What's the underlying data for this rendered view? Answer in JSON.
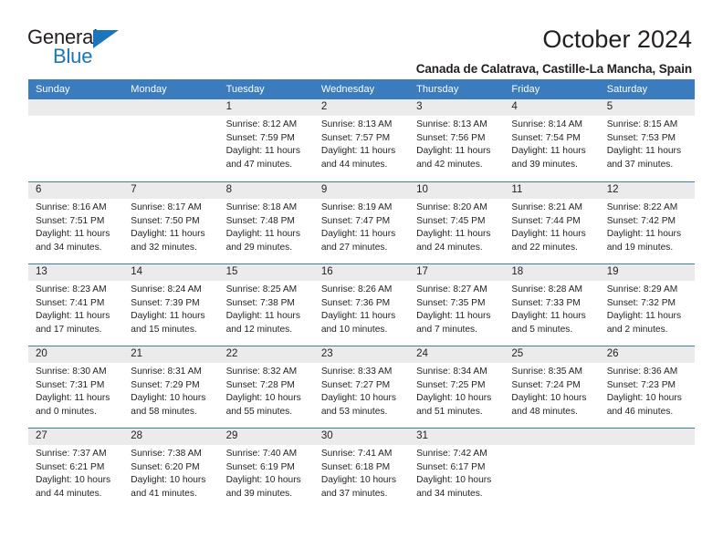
{
  "brand": {
    "name_top": "General",
    "name_bottom": "Blue",
    "triangle_color": "#1b75bb"
  },
  "header": {
    "title": "October 2024",
    "location": "Canada de Calatrava, Castille-La Mancha, Spain"
  },
  "theme": {
    "header_blue": "#3a7cbe",
    "daynum_band": "#ebebeb",
    "text": "#231f20"
  },
  "calendar": {
    "weekdays": [
      "Sunday",
      "Monday",
      "Tuesday",
      "Wednesday",
      "Thursday",
      "Friday",
      "Saturday"
    ],
    "weeks": [
      [
        {
          "day": "",
          "lines": []
        },
        {
          "day": "",
          "lines": []
        },
        {
          "day": "1",
          "lines": [
            "Sunrise: 8:12 AM",
            "Sunset: 7:59 PM",
            "Daylight: 11 hours",
            "and 47 minutes."
          ]
        },
        {
          "day": "2",
          "lines": [
            "Sunrise: 8:13 AM",
            "Sunset: 7:57 PM",
            "Daylight: 11 hours",
            "and 44 minutes."
          ]
        },
        {
          "day": "3",
          "lines": [
            "Sunrise: 8:13 AM",
            "Sunset: 7:56 PM",
            "Daylight: 11 hours",
            "and 42 minutes."
          ]
        },
        {
          "day": "4",
          "lines": [
            "Sunrise: 8:14 AM",
            "Sunset: 7:54 PM",
            "Daylight: 11 hours",
            "and 39 minutes."
          ]
        },
        {
          "day": "5",
          "lines": [
            "Sunrise: 8:15 AM",
            "Sunset: 7:53 PM",
            "Daylight: 11 hours",
            "and 37 minutes."
          ]
        }
      ],
      [
        {
          "day": "6",
          "lines": [
            "Sunrise: 8:16 AM",
            "Sunset: 7:51 PM",
            "Daylight: 11 hours",
            "and 34 minutes."
          ]
        },
        {
          "day": "7",
          "lines": [
            "Sunrise: 8:17 AM",
            "Sunset: 7:50 PM",
            "Daylight: 11 hours",
            "and 32 minutes."
          ]
        },
        {
          "day": "8",
          "lines": [
            "Sunrise: 8:18 AM",
            "Sunset: 7:48 PM",
            "Daylight: 11 hours",
            "and 29 minutes."
          ]
        },
        {
          "day": "9",
          "lines": [
            "Sunrise: 8:19 AM",
            "Sunset: 7:47 PM",
            "Daylight: 11 hours",
            "and 27 minutes."
          ]
        },
        {
          "day": "10",
          "lines": [
            "Sunrise: 8:20 AM",
            "Sunset: 7:45 PM",
            "Daylight: 11 hours",
            "and 24 minutes."
          ]
        },
        {
          "day": "11",
          "lines": [
            "Sunrise: 8:21 AM",
            "Sunset: 7:44 PM",
            "Daylight: 11 hours",
            "and 22 minutes."
          ]
        },
        {
          "day": "12",
          "lines": [
            "Sunrise: 8:22 AM",
            "Sunset: 7:42 PM",
            "Daylight: 11 hours",
            "and 19 minutes."
          ]
        }
      ],
      [
        {
          "day": "13",
          "lines": [
            "Sunrise: 8:23 AM",
            "Sunset: 7:41 PM",
            "Daylight: 11 hours",
            "and 17 minutes."
          ]
        },
        {
          "day": "14",
          "lines": [
            "Sunrise: 8:24 AM",
            "Sunset: 7:39 PM",
            "Daylight: 11 hours",
            "and 15 minutes."
          ]
        },
        {
          "day": "15",
          "lines": [
            "Sunrise: 8:25 AM",
            "Sunset: 7:38 PM",
            "Daylight: 11 hours",
            "and 12 minutes."
          ]
        },
        {
          "day": "16",
          "lines": [
            "Sunrise: 8:26 AM",
            "Sunset: 7:36 PM",
            "Daylight: 11 hours",
            "and 10 minutes."
          ]
        },
        {
          "day": "17",
          "lines": [
            "Sunrise: 8:27 AM",
            "Sunset: 7:35 PM",
            "Daylight: 11 hours",
            "and 7 minutes."
          ]
        },
        {
          "day": "18",
          "lines": [
            "Sunrise: 8:28 AM",
            "Sunset: 7:33 PM",
            "Daylight: 11 hours",
            "and 5 minutes."
          ]
        },
        {
          "day": "19",
          "lines": [
            "Sunrise: 8:29 AM",
            "Sunset: 7:32 PM",
            "Daylight: 11 hours",
            "and 2 minutes."
          ]
        }
      ],
      [
        {
          "day": "20",
          "lines": [
            "Sunrise: 8:30 AM",
            "Sunset: 7:31 PM",
            "Daylight: 11 hours",
            "and 0 minutes."
          ]
        },
        {
          "day": "21",
          "lines": [
            "Sunrise: 8:31 AM",
            "Sunset: 7:29 PM",
            "Daylight: 10 hours",
            "and 58 minutes."
          ]
        },
        {
          "day": "22",
          "lines": [
            "Sunrise: 8:32 AM",
            "Sunset: 7:28 PM",
            "Daylight: 10 hours",
            "and 55 minutes."
          ]
        },
        {
          "day": "23",
          "lines": [
            "Sunrise: 8:33 AM",
            "Sunset: 7:27 PM",
            "Daylight: 10 hours",
            "and 53 minutes."
          ]
        },
        {
          "day": "24",
          "lines": [
            "Sunrise: 8:34 AM",
            "Sunset: 7:25 PM",
            "Daylight: 10 hours",
            "and 51 minutes."
          ]
        },
        {
          "day": "25",
          "lines": [
            "Sunrise: 8:35 AM",
            "Sunset: 7:24 PM",
            "Daylight: 10 hours",
            "and 48 minutes."
          ]
        },
        {
          "day": "26",
          "lines": [
            "Sunrise: 8:36 AM",
            "Sunset: 7:23 PM",
            "Daylight: 10 hours",
            "and 46 minutes."
          ]
        }
      ],
      [
        {
          "day": "27",
          "lines": [
            "Sunrise: 7:37 AM",
            "Sunset: 6:21 PM",
            "Daylight: 10 hours",
            "and 44 minutes."
          ]
        },
        {
          "day": "28",
          "lines": [
            "Sunrise: 7:38 AM",
            "Sunset: 6:20 PM",
            "Daylight: 10 hours",
            "and 41 minutes."
          ]
        },
        {
          "day": "29",
          "lines": [
            "Sunrise: 7:40 AM",
            "Sunset: 6:19 PM",
            "Daylight: 10 hours",
            "and 39 minutes."
          ]
        },
        {
          "day": "30",
          "lines": [
            "Sunrise: 7:41 AM",
            "Sunset: 6:18 PM",
            "Daylight: 10 hours",
            "and 37 minutes."
          ]
        },
        {
          "day": "31",
          "lines": [
            "Sunrise: 7:42 AM",
            "Sunset: 6:17 PM",
            "Daylight: 10 hours",
            "and 34 minutes."
          ]
        },
        {
          "day": "",
          "lines": []
        },
        {
          "day": "",
          "lines": []
        }
      ]
    ]
  }
}
